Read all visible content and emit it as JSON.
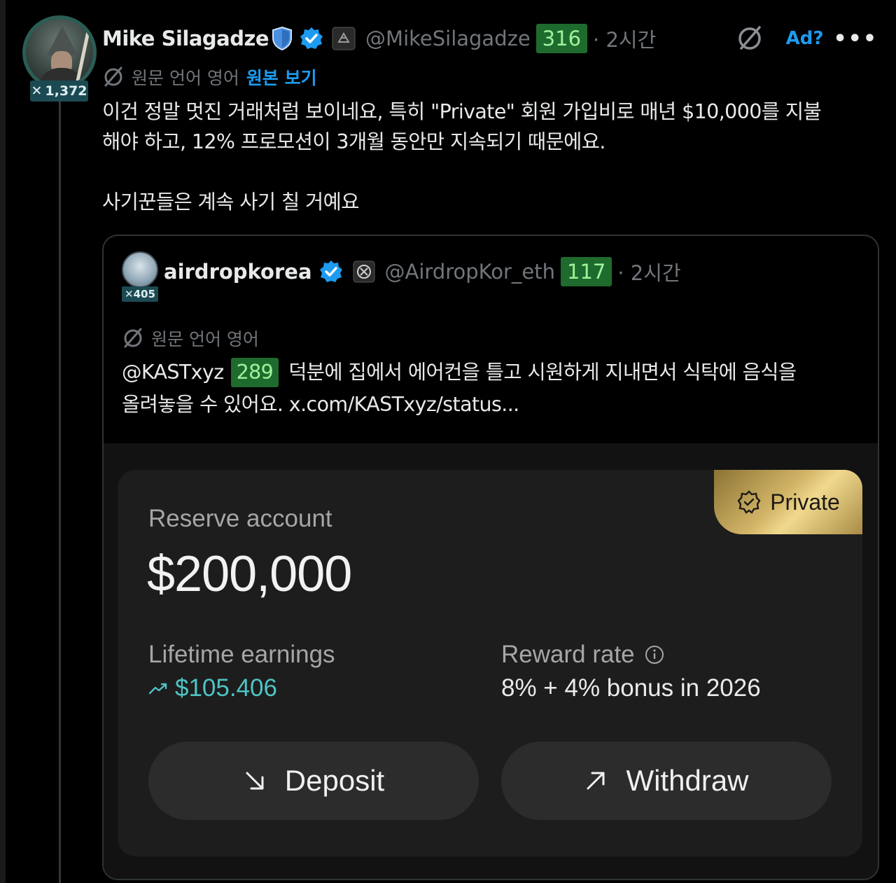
{
  "author": {
    "name": "Mike Silagadze",
    "handle": "@MikeSilagadze",
    "handle_count": "316",
    "time": "· 2시간",
    "score": "1,372"
  },
  "top_actions": {
    "ad_label": "Ad?",
    "more_label": "•••"
  },
  "translation": {
    "label": "원문 언어 영어",
    "view_original": "원본 보기"
  },
  "tweet": {
    "line1": "이건 정말 멋진 거래처럼 보이네요, 특히 \"Private\" 회원 가입비로 매년 $10,000를 지불",
    "line2": "해야 하고, 12% 프로모션이 3개월 동안만 지속되기 때문에요.",
    "line3": "사기꾼들은 계속 사기 칠 거예요"
  },
  "quote": {
    "name": "airdropkorea",
    "handle": "@AirdropKor_eth",
    "handle_count": "117",
    "time": "· 2시간",
    "score": "405",
    "lang_label": "원문 언어 영어",
    "mention": "@KASTxyz",
    "mention_count": "289",
    "text_line1": "덕분에 집에서 에어컨을 틀고 시원하게 지내면서 식탁에 음식을",
    "text_line2": "올려놓을 수 있어요. x.com/KASTxyz/status..."
  },
  "media": {
    "private_label": "Private",
    "reserve_label": "Reserve account",
    "reserve_amount": "$200,000",
    "lifetime_label": "Lifetime earnings",
    "lifetime_value": "$105.406",
    "reward_label": "Reward rate",
    "reward_value": "8% + 4% bonus in 2026",
    "deposit_label": "Deposit",
    "withdraw_label": "Withdraw"
  },
  "colors": {
    "accent_blue": "#1d9bf0",
    "count_green_bg": "#1f6b2e",
    "count_green_text": "#9ff29b",
    "teal_value": "#4fc3c4",
    "gold": "#d3b567"
  }
}
